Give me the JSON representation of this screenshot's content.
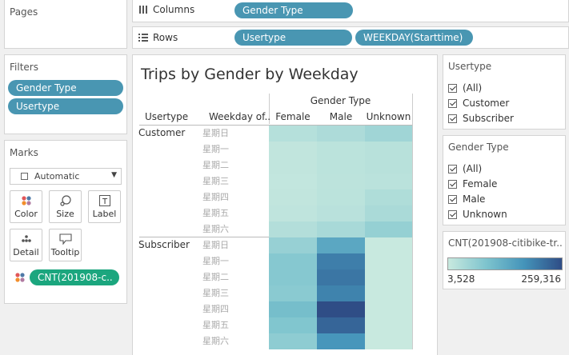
{
  "pages": {
    "title": "Pages"
  },
  "shelves": {
    "columns_label": "Columns",
    "columns_pill": "Gender Type",
    "rows_label": "Rows",
    "rows_pills": [
      "Usertype",
      "WEEKDAY(Starttime)"
    ]
  },
  "filters": {
    "title": "Filters",
    "pills": [
      "Gender Type",
      "Usertype"
    ]
  },
  "marks": {
    "title": "Marks",
    "type": "Automatic",
    "buttons": [
      "Color",
      "Size",
      "Label",
      "Detail",
      "Tooltip"
    ],
    "field_pill": "CNT(201908-c.."
  },
  "chart": {
    "title": "Trips by Gender by Weekday",
    "col_header_group": "Gender Type",
    "row_header_1": "Usertype",
    "row_header_2": "Weekday of..",
    "columns": [
      "Female",
      "Male",
      "Unknown"
    ],
    "groups": [
      "Customer",
      "Subscriber"
    ],
    "weekdays": [
      "星期日",
      "星期一",
      "星期二",
      "星期三",
      "星期四",
      "星期五",
      "星期六"
    ]
  },
  "usertype_filter": {
    "title": "Usertype",
    "items": [
      "(All)",
      "Customer",
      "Subscriber"
    ]
  },
  "gender_filter": {
    "title": "Gender Type",
    "items": [
      "(All)",
      "Female",
      "Male",
      "Unknown"
    ]
  },
  "legend": {
    "title": "CNT(201908-citibike-tr...",
    "min_label": "3,528",
    "max_label": "259,316",
    "min": 3528,
    "max": 259316,
    "color_low": "#c8e9df",
    "color_high": "#2f4d86"
  },
  "colors": {
    "pill": "#4996b2",
    "mark_pill": "#1ba67e"
  },
  "chart_data": {
    "type": "heatmap",
    "title": "Trips by Gender by Weekday",
    "x_categories": [
      "Female",
      "Male",
      "Unknown"
    ],
    "x_label": "Gender Type",
    "y_groups": [
      {
        "name": "Customer",
        "rows": [
          "星期日",
          "星期一",
          "星期二",
          "星期三",
          "星期四",
          "星期五",
          "星期六"
        ],
        "values": [
          [
            25000,
            35000,
            50000
          ],
          [
            12000,
            18000,
            22000
          ],
          [
            12000,
            18000,
            22000
          ],
          [
            11000,
            17000,
            20000
          ],
          [
            12000,
            18000,
            32000
          ],
          [
            14000,
            21000,
            38000
          ],
          [
            28000,
            40000,
            62000
          ]
        ]
      },
      {
        "name": "Subscriber",
        "rows": [
          "星期日",
          "星期一",
          "星期二",
          "星期三",
          "星期四",
          "星期五",
          "星期六"
        ],
        "values": [
          [
            60000,
            140000,
            3528
          ],
          [
            80000,
            200000,
            3700
          ],
          [
            80000,
            210000,
            3800
          ],
          [
            75000,
            195000,
            3700
          ],
          [
            100000,
            259316,
            3900
          ],
          [
            85000,
            230000,
            3800
          ],
          [
            70000,
            170000,
            3600
          ]
        ]
      }
    ],
    "color_range": [
      3528,
      259316
    ]
  }
}
